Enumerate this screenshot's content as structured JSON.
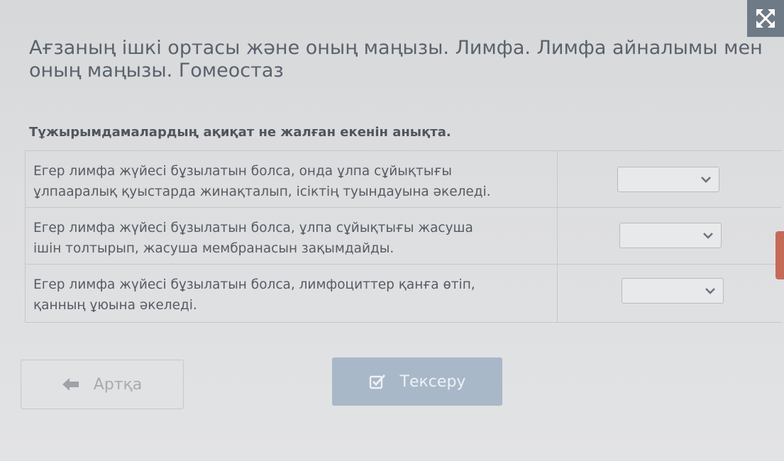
{
  "header": {
    "title": "Ағзаның ішкі ортасы және оның маңызы. Лимфа. Лимфа айналымы мен оның маңызы. Гомеостаз",
    "fullscreen_icon": "expand-arrows-icon"
  },
  "task": {
    "instruction": "Тұжырымдамалардың ақиқат не жалған екенін анықта.",
    "statements": [
      {
        "line1": "Егер лимфа жүйесі бұзылатын болса, онда ұлпа сұйықтығы",
        "line2": "ұлпааралық қуыстарда жинақталып, ісіктің туындауына әкеледі.",
        "selected": ""
      },
      {
        "line1": "Егер лимфа жүйесі бұзылатын болса, ұлпа сұйықтығы жасуша",
        "line2": "ішін толтырып, жасуша мембранасын зақымдайды.",
        "selected": ""
      },
      {
        "line1": "Егер лимфа жүйесі бұзылатын болса, лимфоциттер қанға өтіп,",
        "line2": "қанның ұюына әкеледі.",
        "selected": ""
      }
    ]
  },
  "footer": {
    "back_label": "Артқа",
    "back_icon": "arrow-left-icon",
    "check_label": "Тексеру",
    "check_icon": "checkbox-check-icon"
  },
  "colors": {
    "accent_disabled": "#a9b8c8",
    "scroll_indicator": "#c56a57"
  }
}
